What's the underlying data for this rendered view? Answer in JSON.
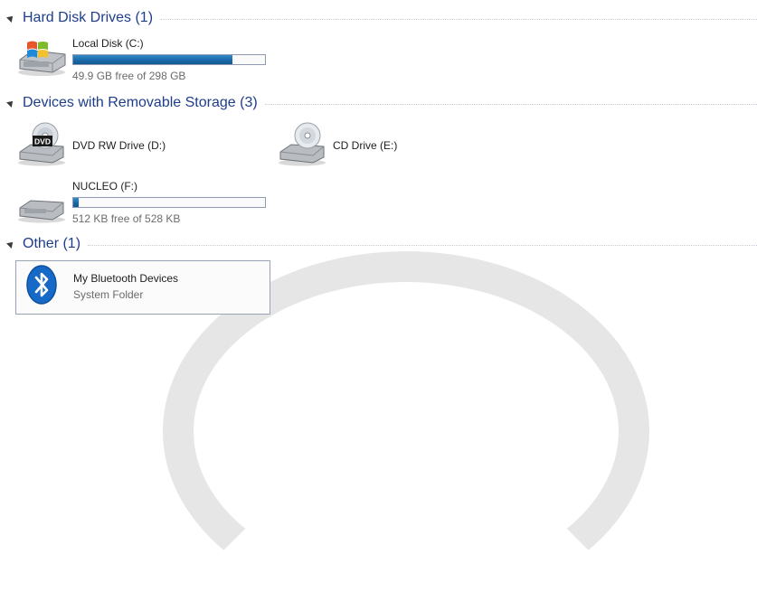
{
  "groups": {
    "hdd": {
      "title": "Hard Disk Drives (1)"
    },
    "removable": {
      "title": "Devices with Removable Storage (3)"
    },
    "other": {
      "title": "Other (1)"
    }
  },
  "drives": {
    "local_c": {
      "name": "Local Disk (C:)",
      "free_text": "49.9 GB free of 298 GB",
      "used_fraction": 0.83,
      "icon": "hard-disk-windows-icon"
    },
    "dvd_d": {
      "name": "DVD RW Drive (D:)",
      "icon": "dvd-drive-icon",
      "badge": "DVD"
    },
    "cd_e": {
      "name": "CD Drive (E:)",
      "icon": "cd-drive-icon"
    },
    "nucleo_f": {
      "name": "NUCLEO (F:)",
      "free_text": "512 KB free of 528 KB",
      "used_fraction": 0.03,
      "icon": "removable-disk-icon"
    },
    "bluetooth": {
      "name": "My Bluetooth Devices",
      "sub": "System Folder",
      "icon": "bluetooth-icon"
    }
  },
  "colors": {
    "header": "#1e3d8a",
    "bar_fill": "#1a6aa9",
    "bluetooth": "#1769c8"
  }
}
